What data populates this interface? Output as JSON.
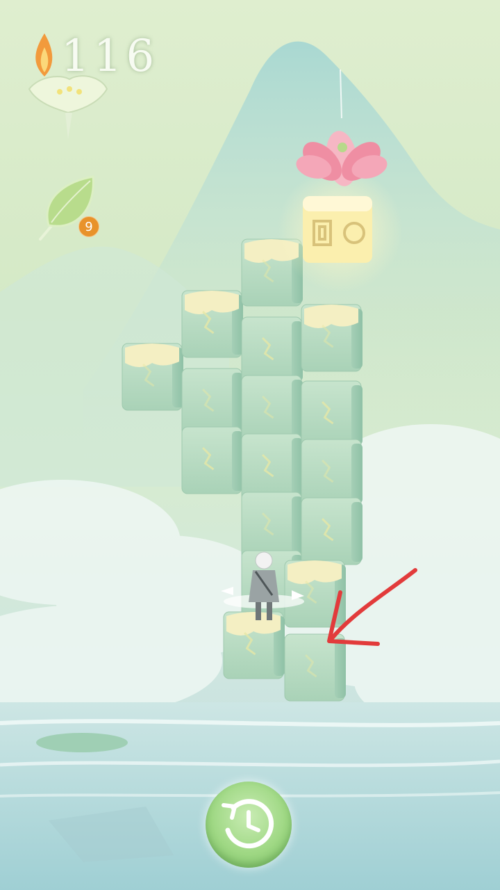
{
  "hud": {
    "flame_count": "116",
    "leaf_count": "9"
  },
  "icons": {
    "flame": "flame-icon",
    "lotus_bowl": "lotus-bowl-icon",
    "leaf": "leaf-icon",
    "rewind": "rewind-clock-icon",
    "lotus_goal": "lotus-flower-icon",
    "annotation": "red-arrow-annotation"
  },
  "colors": {
    "block_face": "#b9dcc4",
    "block_top": "#f4efc3",
    "goal_block": "#fbf1b0",
    "lotus": "#ef7f97",
    "annotation_arrow": "#e23b3b",
    "rewind_button": "#9fd884"
  }
}
